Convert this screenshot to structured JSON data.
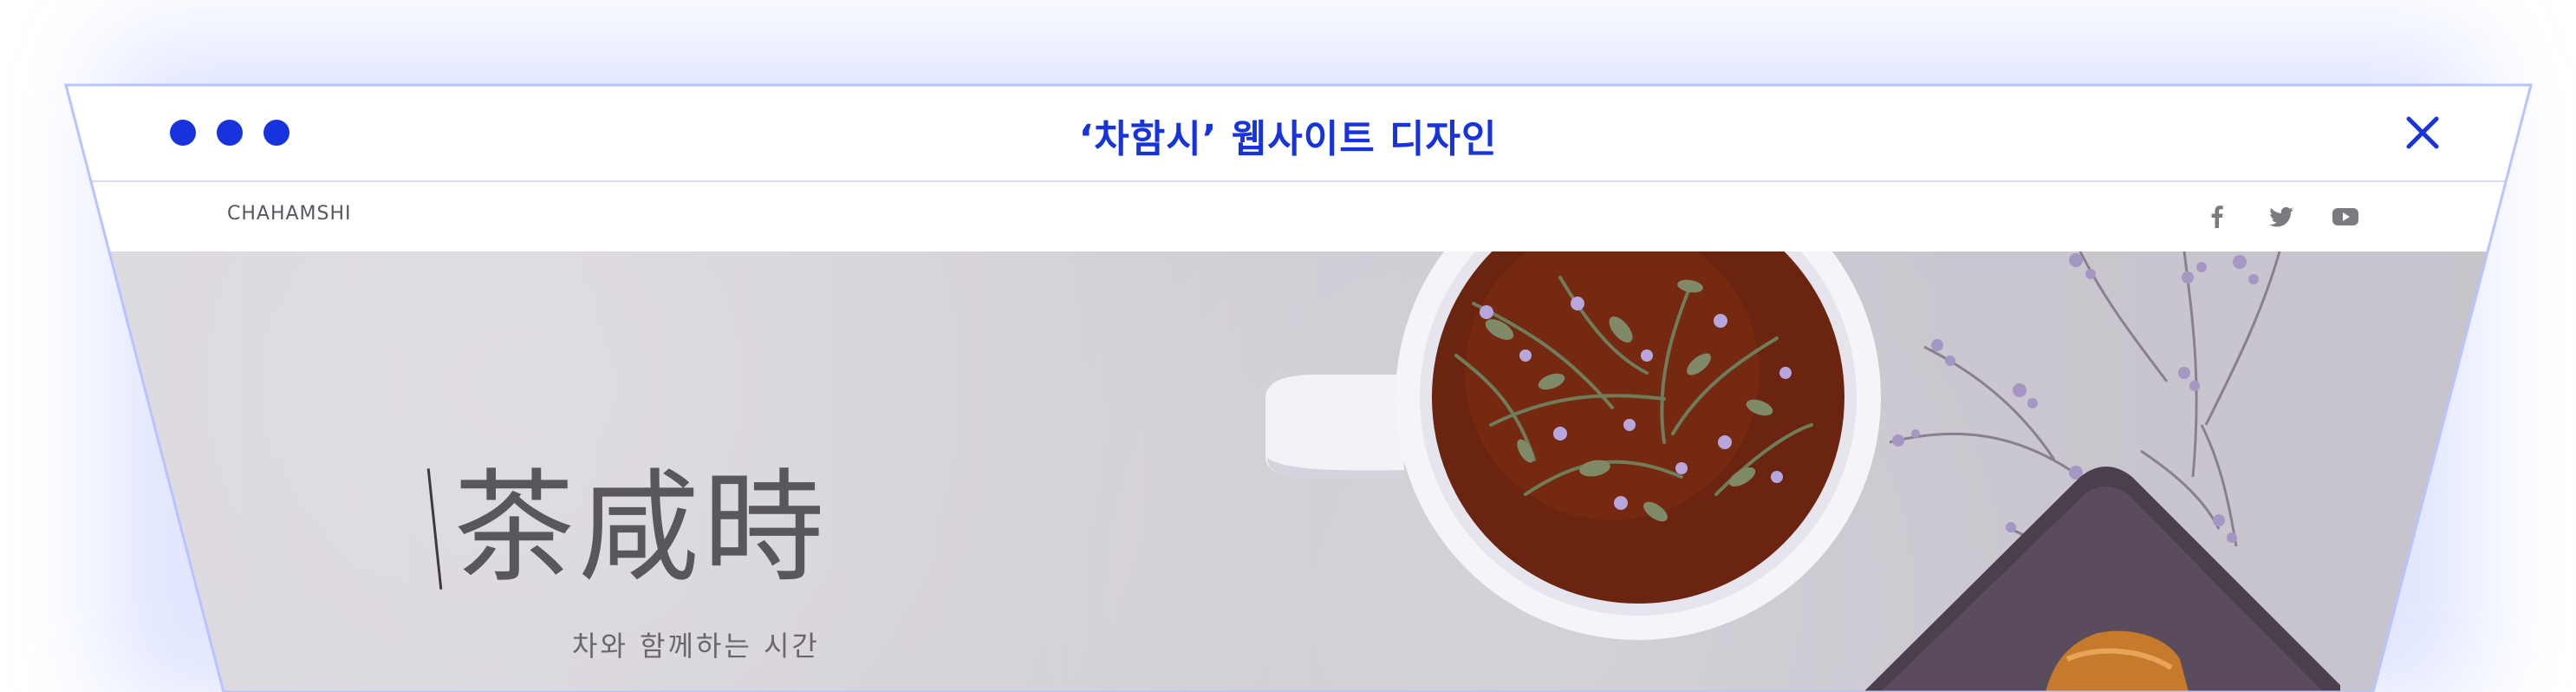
{
  "window": {
    "title": "‘차함시’ 웹사이트 디자인",
    "accent_color": "#1633dd",
    "controls": [
      "dot",
      "dot",
      "dot"
    ],
    "close_icon": "close-icon"
  },
  "navbar": {
    "brand": "CHAHAMSHI",
    "social_icons": [
      "facebook-icon",
      "twitter-icon",
      "youtube-icon"
    ]
  },
  "hero": {
    "title": "茶咸時",
    "subtitle": "차와 함께하는 시간"
  }
}
